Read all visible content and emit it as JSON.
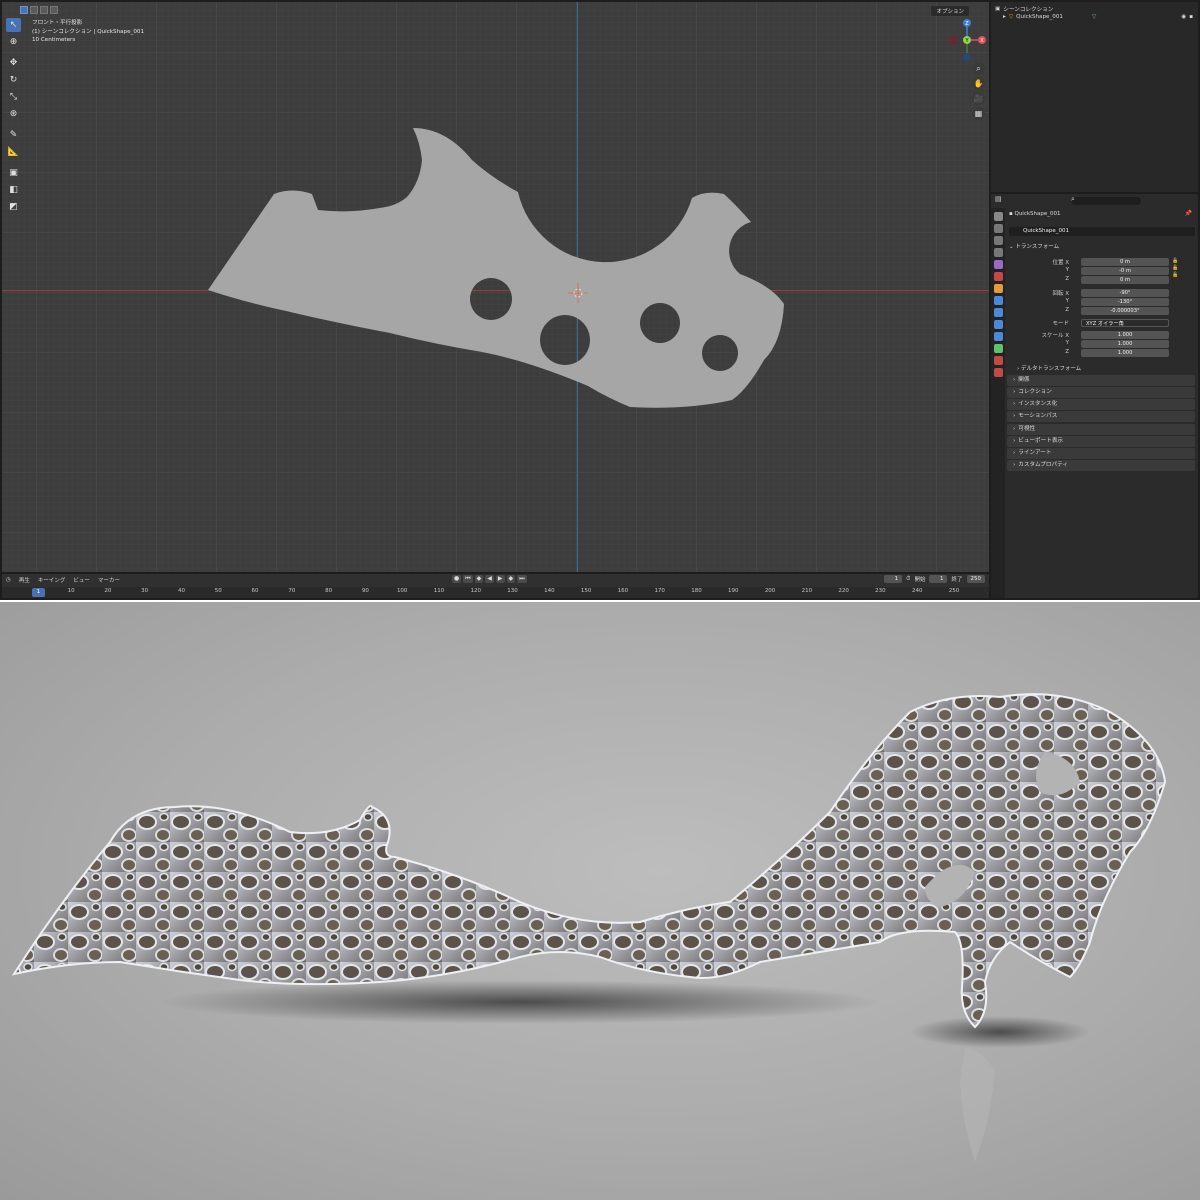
{
  "viewport": {
    "view_name": "フロント・平行投影",
    "collection_line": "(1) シーンコレクション | QuickShape_001",
    "scale_line": "10 Centimeters",
    "options_label": "オプション"
  },
  "toolbar_icons": [
    "select-box-icon",
    "cursor-icon",
    "move-icon",
    "rotate-icon",
    "scale-icon",
    "transform-icon",
    "annotate-icon",
    "measure-icon",
    "add-cube-icon",
    "extrude-icon",
    "quickshape-icon"
  ],
  "gizmo": {
    "z_label": "Z",
    "y_label": "Y",
    "x_label": "X"
  },
  "timeline": {
    "menus": [
      "再生",
      "キーイング",
      "ビュー",
      "マーカー"
    ],
    "current_frame": "1",
    "start_label": "開始",
    "start_value": "1",
    "end_label": "終了",
    "end_value": "250",
    "ticks": [
      "10",
      "20",
      "30",
      "40",
      "50",
      "60",
      "70",
      "80",
      "90",
      "100",
      "110",
      "120",
      "130",
      "140",
      "150",
      "160",
      "170",
      "180",
      "190",
      "200",
      "210",
      "220",
      "230",
      "240",
      "250"
    ],
    "ruler_current": "1"
  },
  "outliner": {
    "title": "シーンコレクション",
    "item": "QuickShape_001"
  },
  "properties": {
    "object_name": "QuickShape_001",
    "object_field": "QuickShape_001",
    "transform_title": "トランスフォーム",
    "location_label": "位置 X",
    "loc": [
      "0 m",
      "-0 m",
      "0 m"
    ],
    "rotation_label": "回転 X",
    "rot": [
      "-90°",
      "-130°",
      "-0.000003°"
    ],
    "mode_label": "モード",
    "mode_value": "XYZ オイラー角",
    "scale_label": "スケール X",
    "scale": [
      "1.000",
      "1.000",
      "1.000"
    ],
    "axis_y": "Y",
    "axis_z": "Z",
    "delta_transform": "デルタトランスフォーム",
    "panels": [
      "関係",
      "コレクション",
      "インスタンス化",
      "モーションパス",
      "可視性",
      "ビューポート表示",
      "ラインアート",
      "カスタムプロパティ"
    ]
  },
  "colors": {
    "accent_blue": "#4772b3",
    "shape_fill": "#a6a6a6",
    "axis_red": "#9a3b3f",
    "axis_blue": "#2f6f99"
  }
}
